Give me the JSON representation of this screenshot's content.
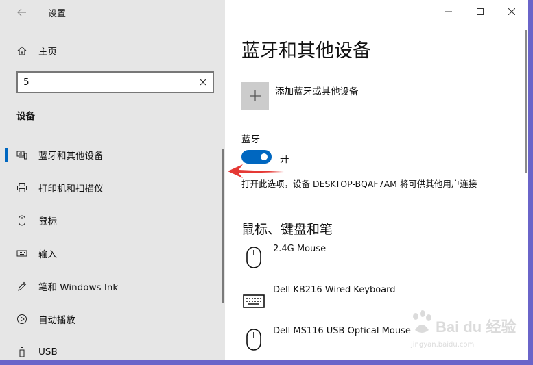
{
  "window": {
    "app_title": "设置"
  },
  "sidebar": {
    "home_label": "主页",
    "search": {
      "value": "5",
      "placeholder": ""
    },
    "section_title": "设备",
    "items": [
      {
        "label": "蓝牙和其他设备",
        "icon": "bluetooth-devices-icon",
        "active": true
      },
      {
        "label": "打印机和扫描仪",
        "icon": "printer-icon",
        "active": false
      },
      {
        "label": "鼠标",
        "icon": "mouse-icon",
        "active": false
      },
      {
        "label": "输入",
        "icon": "keyboard-icon",
        "active": false
      },
      {
        "label": "笔和 Windows Ink",
        "icon": "pen-icon",
        "active": false
      },
      {
        "label": "自动播放",
        "icon": "autoplay-icon",
        "active": false
      },
      {
        "label": "USB",
        "icon": "usb-icon",
        "active": false
      }
    ]
  },
  "main": {
    "title": "蓝牙和其他设备",
    "add_device_label": "添加蓝牙或其他设备",
    "bluetooth": {
      "label": "蓝牙",
      "state": "开",
      "on": true,
      "description": "打开此选项，设备 DESKTOP-BQAF7AM 将可供其他用户连接"
    },
    "section_title": "鼠标、键盘和笔",
    "devices": [
      {
        "name": "2.4G Mouse",
        "icon": "mouse-icon"
      },
      {
        "name": "Dell KB216 Wired Keyboard",
        "icon": "keyboard-icon"
      },
      {
        "name": "Dell MS116 USB Optical Mouse",
        "icon": "mouse-icon"
      }
    ]
  },
  "watermark": {
    "brand": "Bai du 经验",
    "url": "jingyan.baidu.com"
  },
  "colors": {
    "accent": "#0067c0",
    "sidebar_bg": "#e6e6e6",
    "desktop_bg": "#6a64c9",
    "annotation_arrow": "#e53935"
  }
}
